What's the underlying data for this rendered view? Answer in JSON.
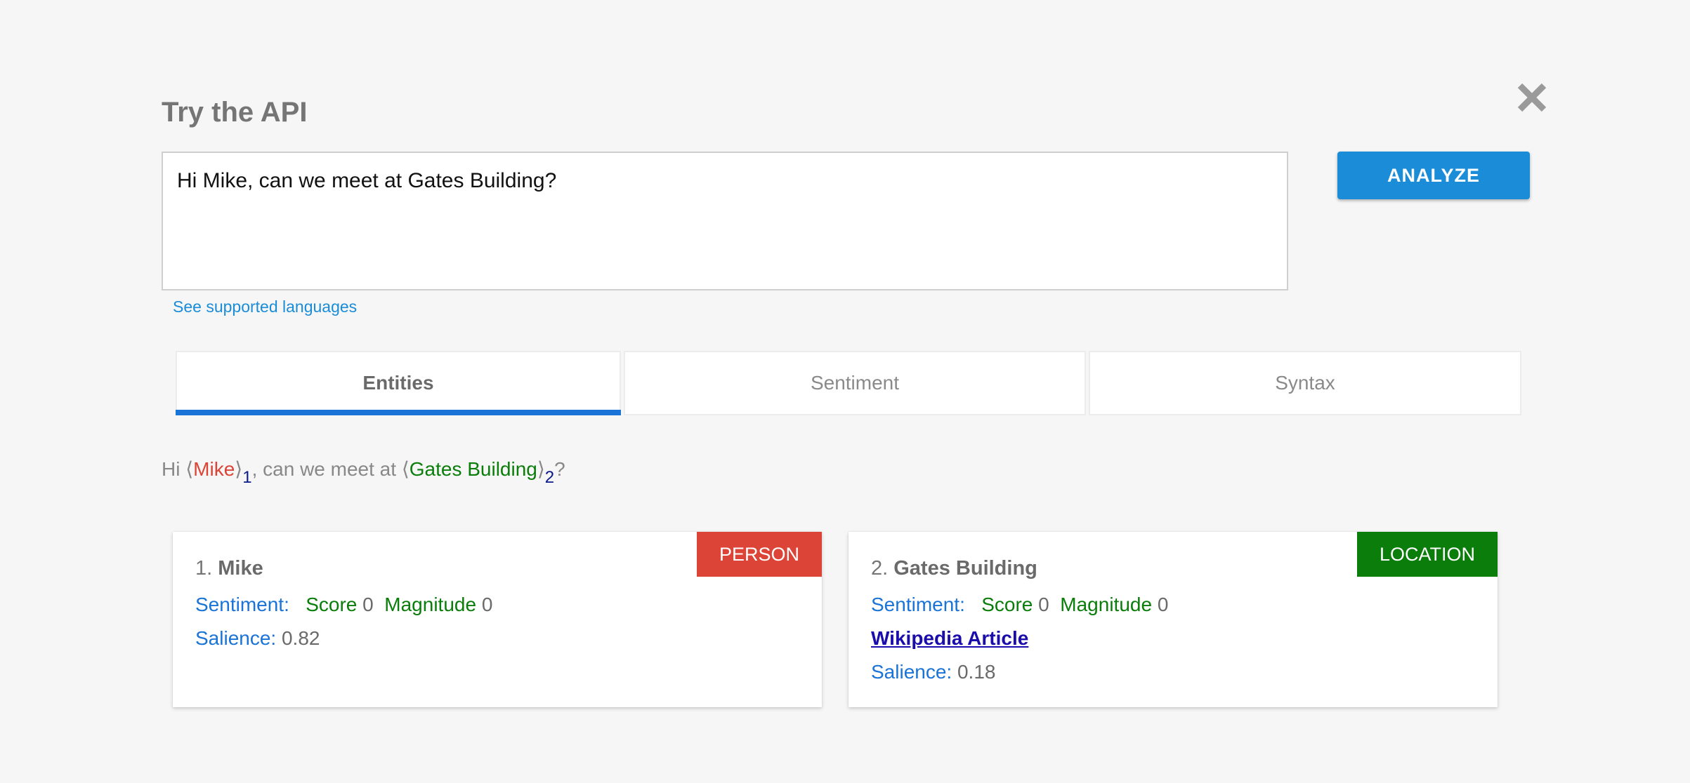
{
  "dialog": {
    "title": "Try the API",
    "close_icon": "close-icon"
  },
  "input": {
    "value": "Hi Mike, can we meet at Gates Building?",
    "analyze_label": "ANALYZE",
    "supported_languages_link": "See supported languages"
  },
  "tabs": [
    {
      "label": "Entities",
      "active": true
    },
    {
      "label": "Sentiment",
      "active": false
    },
    {
      "label": "Syntax",
      "active": false
    }
  ],
  "annotated_text": {
    "prefix": "Hi ",
    "middle": ", can we meet at ",
    "suffix": "?",
    "open_bracket": "⟨",
    "close_bracket": "⟩",
    "entity1": {
      "text": "Mike",
      "index": "1"
    },
    "entity2": {
      "text": "Gates Building",
      "index": "2"
    }
  },
  "entities": [
    {
      "number": "1.",
      "name": "Mike",
      "type": "PERSON",
      "type_color": "#db4437",
      "sentiment_label": "Sentiment:",
      "score_label": "Score",
      "score": "0",
      "magnitude_label": "Magnitude",
      "magnitude": "0",
      "salience_label": "Salience:",
      "salience": "0.82"
    },
    {
      "number": "2.",
      "name": "Gates Building",
      "type": "LOCATION",
      "type_color": "#0a7d0a",
      "sentiment_label": "Sentiment:",
      "score_label": "Score",
      "score": "0",
      "magnitude_label": "Magnitude",
      "magnitude": "0",
      "wikipedia_link": "Wikipedia Article",
      "salience_label": "Salience:",
      "salience": "0.18"
    }
  ],
  "colors": {
    "accent": "#1a8cd8",
    "tab_indicator": "#1a73d6",
    "person": "#db4437",
    "location": "#0a7d0a"
  }
}
